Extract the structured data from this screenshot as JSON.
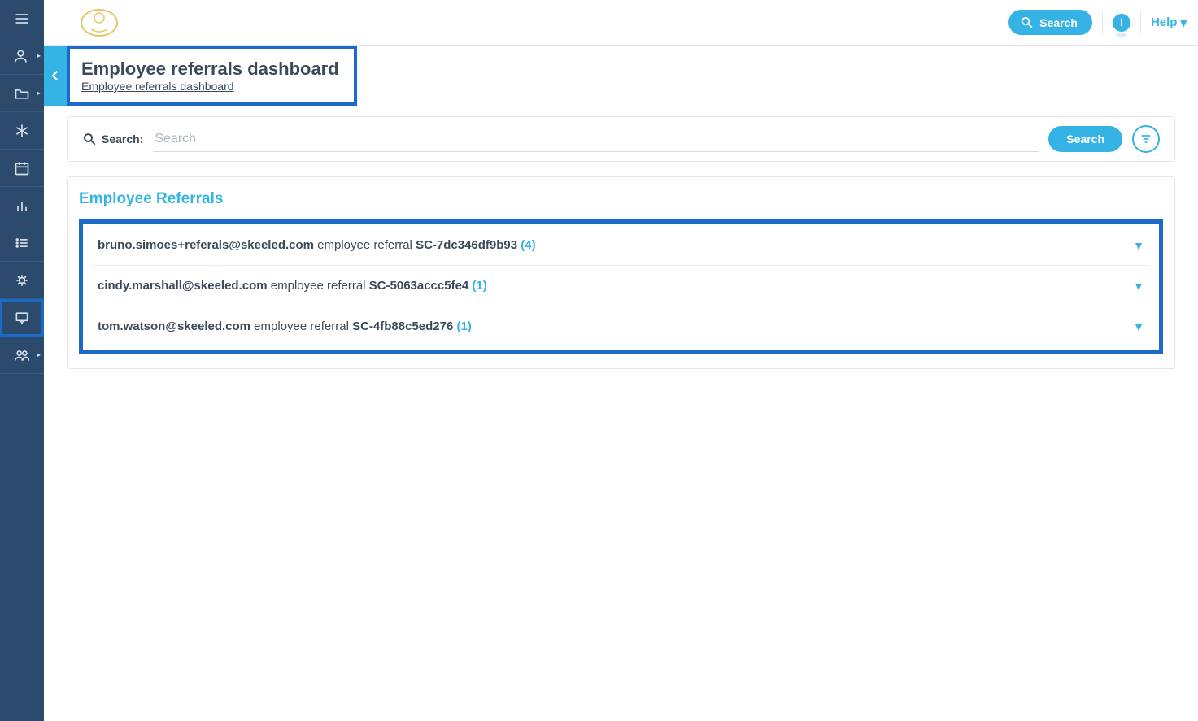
{
  "topbar": {
    "search_button": "Search",
    "help_label": "Help"
  },
  "page": {
    "title": "Employee referrals dashboard",
    "breadcrumb": "Employee referrals dashboard"
  },
  "search": {
    "label": "Search:",
    "placeholder": "Search",
    "button": "Search"
  },
  "section": {
    "title": "Employee Referrals"
  },
  "referrals": [
    {
      "email": "bruno.simoes+referals@skeeled.com",
      "middle": "employee referral",
      "code": "SC-7dc346df9b93",
      "count": "(4)"
    },
    {
      "email": "cindy.marshall@skeeled.com",
      "middle": "employee referral",
      "code": "SC-5063accc5fe4",
      "count": "(1)"
    },
    {
      "email": "tom.watson@skeeled.com",
      "middle": "employee referral",
      "code": "SC-4fb88c5ed276",
      "count": "(1)"
    }
  ]
}
